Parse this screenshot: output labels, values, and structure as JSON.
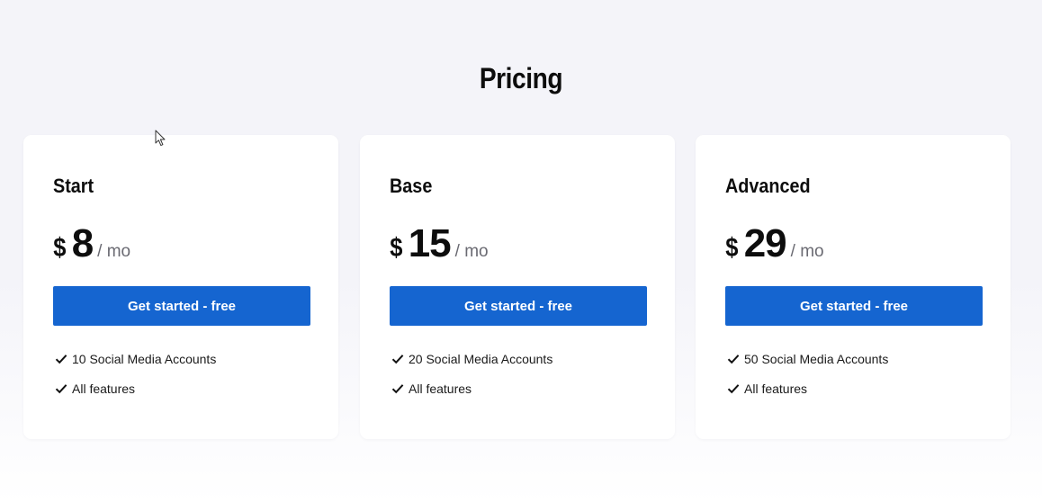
{
  "page": {
    "title": "Pricing"
  },
  "plans": [
    {
      "name": "Start",
      "currency": "$",
      "price": "8",
      "period": "/ mo",
      "cta_label": "Get started - free",
      "features": [
        "10 Social Media Accounts",
        "All features"
      ]
    },
    {
      "name": "Base",
      "currency": "$",
      "price": "15",
      "period": "/ mo",
      "cta_label": "Get started - free",
      "features": [
        "20 Social Media Accounts",
        "All features"
      ]
    },
    {
      "name": "Advanced",
      "currency": "$",
      "price": "29",
      "period": "/ mo",
      "cta_label": "Get started - free",
      "features": [
        "50 Social Media Accounts",
        "All features"
      ]
    }
  ],
  "icons": {
    "feature_bullet": "check-icon",
    "pointer": "mouse-cursor-icon"
  },
  "colors": {
    "accent": "#1565d0",
    "background": "#f4f4f9",
    "card": "#ffffff",
    "muted_text": "#6a6a72"
  }
}
